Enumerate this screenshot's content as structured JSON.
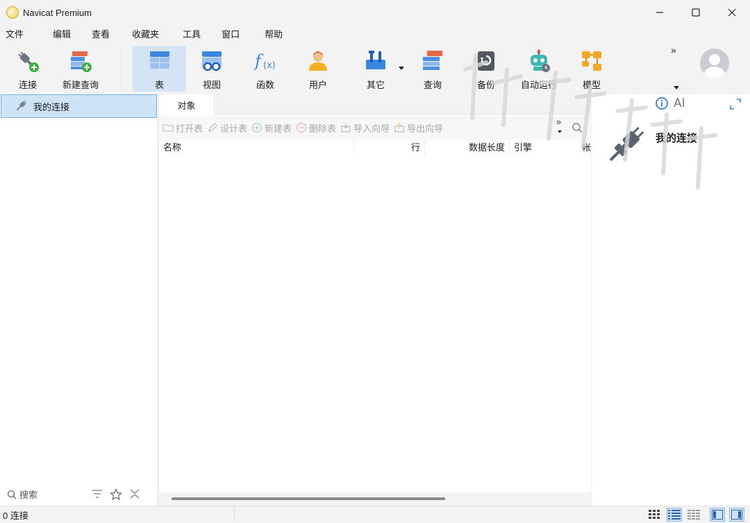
{
  "window": {
    "title": "Navicat Premium",
    "minimize_icon": "minimize-icon",
    "maximize_icon": "maximize-icon",
    "close_icon": "close-icon"
  },
  "menu": [
    "文件",
    "编辑",
    "查看",
    "收藏夹",
    "工具",
    "窗口",
    "帮助"
  ],
  "toolbar": {
    "items": [
      {
        "label": "连接",
        "icon": "plug-add-icon"
      },
      {
        "label": "新建查询",
        "icon": "new-query-icon"
      },
      {
        "label": "表",
        "icon": "table-icon",
        "active": true
      },
      {
        "label": "视图",
        "icon": "view-icon"
      },
      {
        "label": "函数",
        "icon": "function-icon"
      },
      {
        "label": "用户",
        "icon": "user-icon"
      },
      {
        "label": "其它",
        "icon": "tools-icon"
      },
      {
        "label": "查询",
        "icon": "query-icon"
      },
      {
        "label": "备份",
        "icon": "backup-icon"
      },
      {
        "label": "自动运行",
        "icon": "robot-icon"
      },
      {
        "label": "模型",
        "icon": "model-icon"
      }
    ],
    "more": "»"
  },
  "left_panel": {
    "connection_label": "我的连接",
    "search_placeholder": "搜索"
  },
  "center_panel": {
    "tab": "对象",
    "object_toolbar": [
      "打开表",
      "设计表",
      "新建表",
      "删除表",
      "导入向导",
      "导出向导"
    ],
    "more": "»",
    "columns": [
      "名称",
      "行",
      "数据长度",
      "引擎",
      "帐"
    ]
  },
  "right_panel": {
    "ai_label": "AI",
    "title": "我的连接"
  },
  "statusbar": {
    "text": "0 连接"
  },
  "colors": {
    "accent": "#3a7fd5",
    "selection": "#cde3f7",
    "active_tool": "#d4e4f5"
  }
}
